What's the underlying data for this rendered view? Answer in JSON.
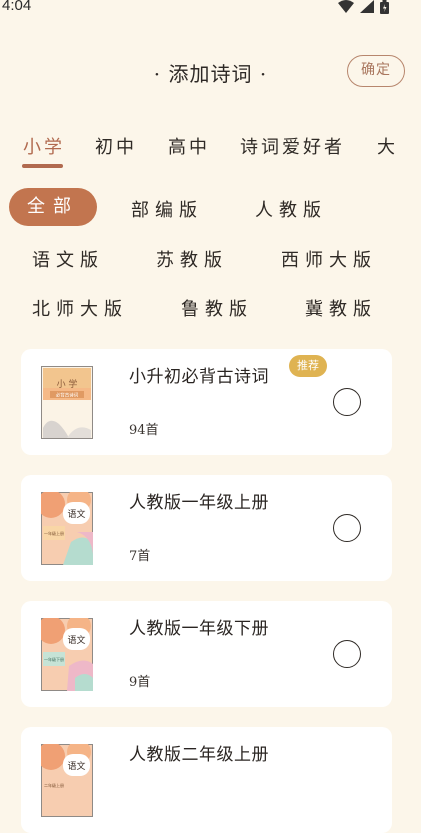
{
  "status_bar": {
    "time": "4:04"
  },
  "header": {
    "title": "· 添加诗词 ·",
    "confirm_label": "确定"
  },
  "tabs": [
    "小学",
    "初中",
    "高中",
    "诗词爱好者",
    "大"
  ],
  "editions": [
    "全部",
    "部编版",
    "人教版",
    "语文版",
    "苏教版",
    "西师大版",
    "北师大版",
    "鲁教版",
    "冀教版"
  ],
  "books": [
    {
      "title": "小升初必背古诗词",
      "count": "94首",
      "badge": "推荐",
      "cover_title": "小 学",
      "cover_subtitle": "必背古诗词"
    },
    {
      "title": "人教版一年级上册",
      "count": "7首",
      "cover_tag": "语文",
      "cover_grade": "一年级上册"
    },
    {
      "title": "人教版一年级下册",
      "count": "9首",
      "cover_tag": "语文",
      "cover_grade": "一年级下册"
    },
    {
      "title": "人教版二年级上册",
      "count": "",
      "cover_tag": "语文",
      "cover_grade": "二年级上册"
    }
  ],
  "colors": {
    "accent": "#b16a4f",
    "chip_selected": "#c2754f",
    "badge": "#dfb352",
    "background": "#fcf6ea"
  }
}
